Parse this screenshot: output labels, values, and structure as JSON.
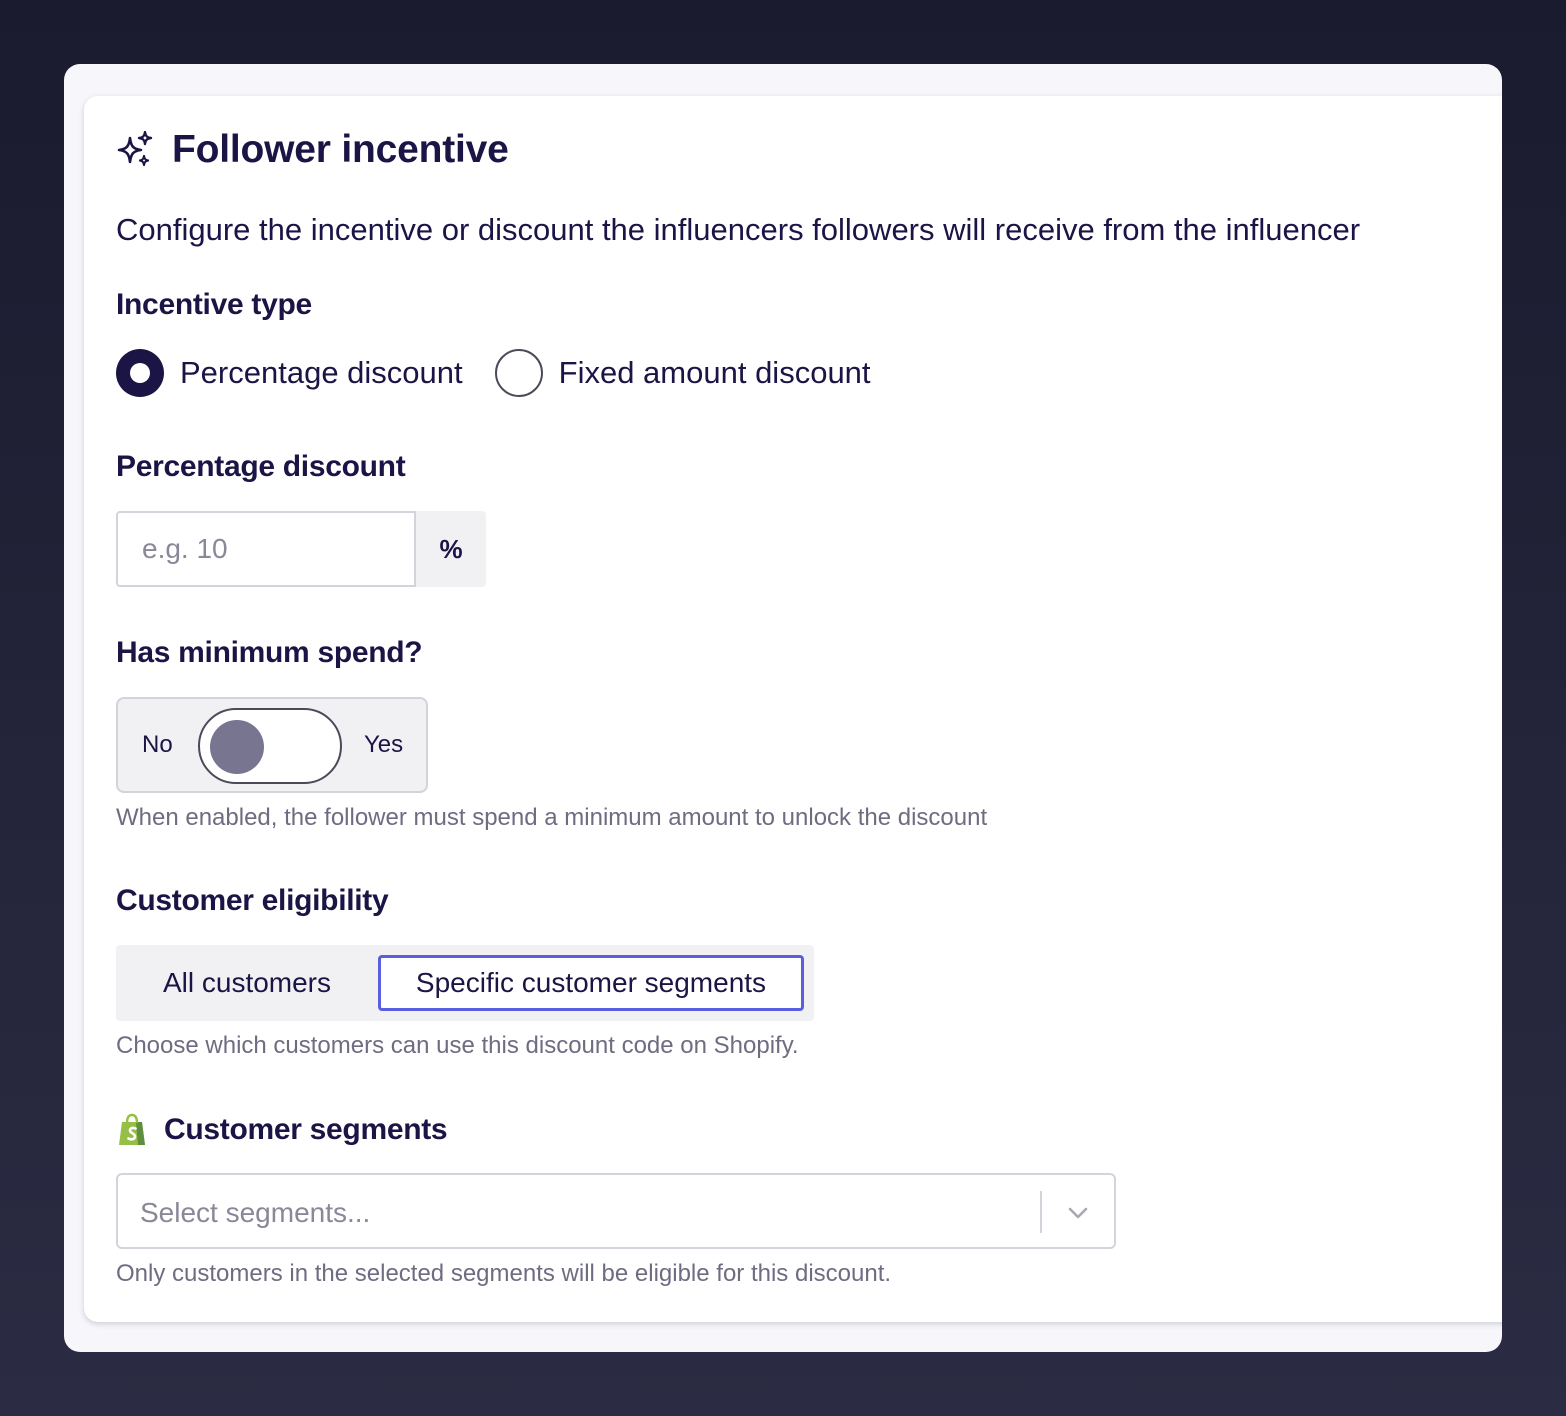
{
  "card": {
    "title": "Follower incentive",
    "description": "Configure the incentive or discount the influencers followers will receive from the influencer",
    "icon": "sparkles-icon"
  },
  "incentive_type": {
    "label": "Incentive type",
    "options": [
      {
        "label": "Percentage discount",
        "selected": true
      },
      {
        "label": "Fixed amount discount",
        "selected": false
      }
    ]
  },
  "percentage_discount": {
    "label": "Percentage discount",
    "placeholder": "e.g. 10",
    "value": "",
    "suffix": "%"
  },
  "minimum_spend": {
    "label": "Has minimum spend?",
    "off_label": "No",
    "on_label": "Yes",
    "enabled": false,
    "helper": "When enabled, the follower must spend a minimum amount to unlock the discount"
  },
  "customer_eligibility": {
    "label": "Customer eligibility",
    "options": [
      "All customers",
      "Specific customer segments"
    ],
    "selected": "Specific customer segments",
    "helper": "Choose which customers can use this discount code on Shopify."
  },
  "customer_segments": {
    "label": "Customer segments",
    "icon": "shopify-icon",
    "placeholder": "Select segments...",
    "helper": "Only customers in the selected segments will be eligible for this discount."
  },
  "colors": {
    "text_primary": "#1b1546",
    "text_muted": "#6f6c82",
    "accent": "#5a5fe0",
    "shopify_green": "#95bf47",
    "background_dark": "#1b1b2f"
  }
}
